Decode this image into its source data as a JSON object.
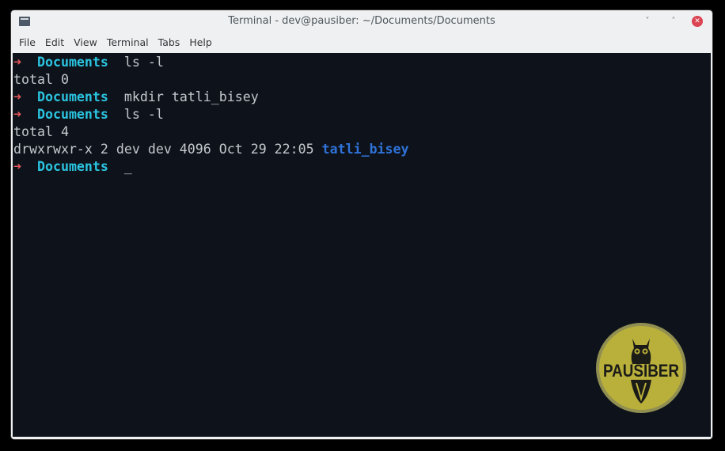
{
  "window": {
    "title": "Terminal - dev@pausiber: ~/Documents/Documents",
    "minimize_glyph": "˅",
    "maximize_glyph": "˄",
    "close_glyph": "✕"
  },
  "menu": [
    "File",
    "Edit",
    "View",
    "Terminal",
    "Tabs",
    "Help"
  ],
  "terminal": {
    "prompt_arrow": "➜",
    "prompt_dir": "Documents",
    "cmd1": "ls -l",
    "out1": "total 0",
    "cmd2": "mkdir tatli_bisey",
    "cmd3": "ls -l",
    "out3": "total 4",
    "out4_prefix": "drwxrwxr-x 2 dev dev 4096 Oct 29 22:05 ",
    "out4_name": "tatli_bisey",
    "cursor": "_"
  },
  "watermark": {
    "text": "PAUSIBER",
    "colors": {
      "fill": "#bdb33a",
      "ring": "#a8a45a"
    }
  },
  "colors": {
    "terminal_bg": "#0e131b",
    "prompt_arrow": "#e8585c",
    "prompt_dir": "#2bc4e0",
    "directory_listing": "#2f72d8",
    "close_button": "#da4453"
  }
}
